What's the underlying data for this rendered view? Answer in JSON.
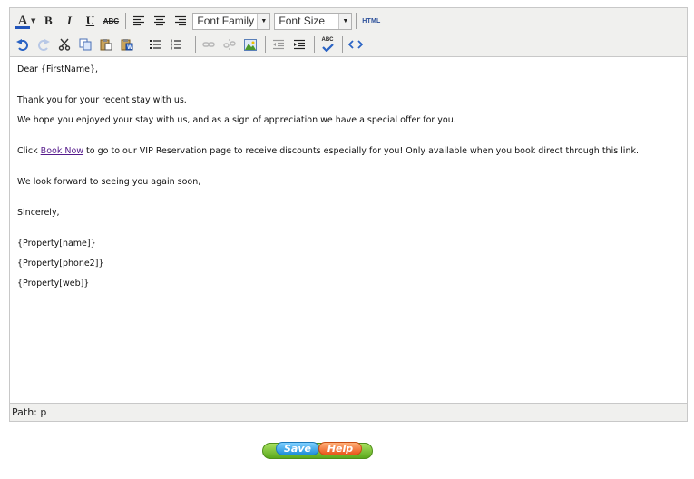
{
  "toolbar": {
    "font_family": "Font Family",
    "font_size": "Font Size",
    "bold": "B",
    "italic": "I",
    "underline": "U",
    "strike": "ABC",
    "color_letter": "A",
    "html": "HTML",
    "spell": "ABC"
  },
  "content": {
    "greeting": "Dear {FirstName},",
    "line1": "Thank you for your recent stay with us.",
    "line2": "We hope you enjoyed your stay with us, and as a sign of appreciation we have a special offer for you.",
    "click_prefix": "Click ",
    "link_text": "Book Now",
    "click_suffix": " to go to our VIP Reservation page to receive discounts especially for you! Only available when you book direct through this link.",
    "line4": "We look forward to seeing you again soon,",
    "closing": "Sincerely,",
    "prop_name": "{Property[name]}",
    "prop_phone": "{Property[phone2]}",
    "prop_web": "{Property[web]}"
  },
  "status": {
    "path": "Path: p"
  },
  "buttons": {
    "save": "Save",
    "help": "Help"
  },
  "colors": {
    "toolbar_bg": "#f0f0ee",
    "link": "#551a8b",
    "save": "#1f8fd9",
    "help": "#e8561a",
    "base": "#5aa81c"
  }
}
